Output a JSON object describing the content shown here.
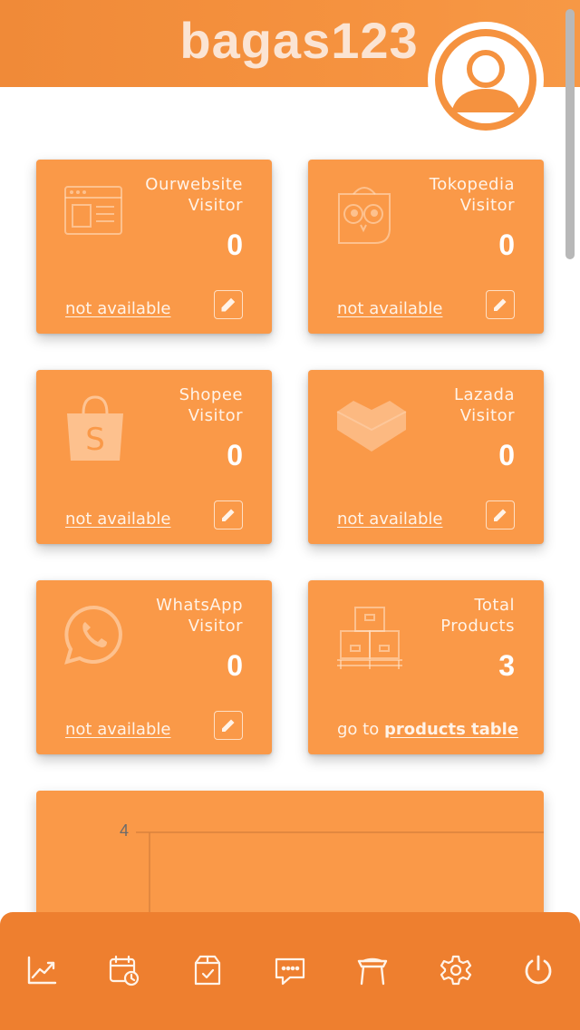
{
  "header": {
    "username": "bagas123"
  },
  "icons": {
    "avatar": "user-circle-icon",
    "ourwebsite": "browser-window-icon",
    "tokopedia": "tokopedia-owl-icon",
    "shopee": "shopee-bag-icon",
    "lazada": "lazada-heart-icon",
    "whatsapp": "whatsapp-icon",
    "products": "boxes-on-pallet-icon",
    "edit": "pencil-icon"
  },
  "colors": {
    "primary": "#f5923f",
    "card": "#fa9948",
    "bottombar": "#ee7f2f"
  },
  "cards": {
    "ourwebsite": {
      "title1": "Ourwebsite",
      "title2": "Visitor",
      "count": "0",
      "link": "not available"
    },
    "tokopedia": {
      "title1": "Tokopedia",
      "title2": "Visitor",
      "count": "0",
      "link": "not available"
    },
    "shopee": {
      "title1": "Shopee",
      "title2": "Visitor",
      "count": "0",
      "link": "not available"
    },
    "lazada": {
      "title1": "Lazada",
      "title2": "Visitor",
      "count": "0",
      "link": "not available"
    },
    "whatsapp": {
      "title1": "WhatsApp",
      "title2": "Visitor",
      "count": "0",
      "link": "not available"
    },
    "products": {
      "title1": "Total",
      "title2": "Products",
      "count": "3",
      "goto_prefix": "go to",
      "goto_link": "products table"
    }
  },
  "chart": {
    "y_tick_top": "4"
  },
  "bottom_nav": [
    {
      "name": "analytics",
      "icon": "trending-up-icon"
    },
    {
      "name": "schedule",
      "icon": "calendar-clock-icon"
    },
    {
      "name": "orders",
      "icon": "box-check-icon"
    },
    {
      "name": "messages",
      "icon": "chat-bubble-icon"
    },
    {
      "name": "store",
      "icon": "storefront-icon"
    },
    {
      "name": "settings",
      "icon": "gear-icon"
    },
    {
      "name": "logout",
      "icon": "power-icon"
    }
  ]
}
